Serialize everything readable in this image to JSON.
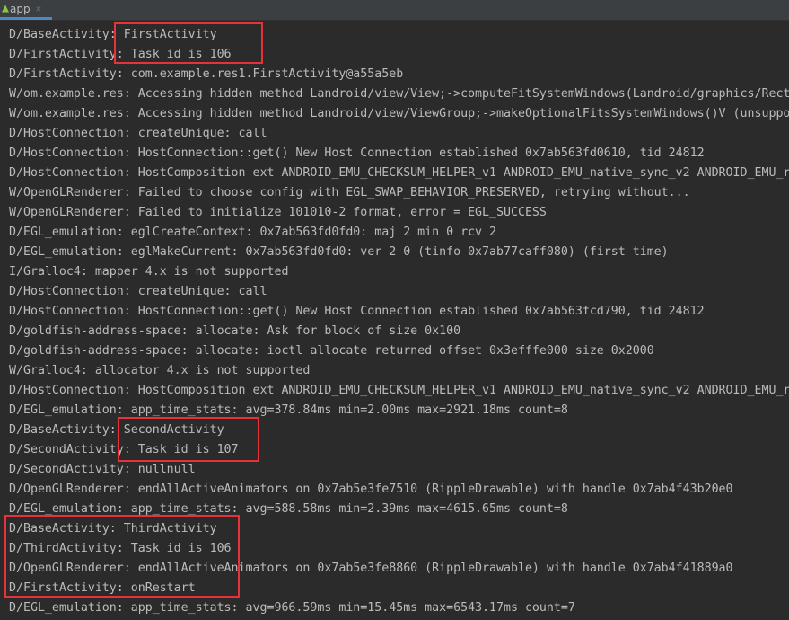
{
  "tab": {
    "label": "app",
    "close": "✕"
  },
  "highlight_color": "#e8323a",
  "log_lines": [
    "D/BaseActivity: FirstActivity",
    "D/FirstActivity: Task id is 106",
    "D/FirstActivity: com.example.res1.FirstActivity@a55a5eb",
    "W/om.example.res: Accessing hidden method Landroid/view/View;->computeFitSystemWindows(Landroid/graphics/Rect",
    "W/om.example.res: Accessing hidden method Landroid/view/ViewGroup;->makeOptionalFitsSystemWindows()V (unsuppo",
    "D/HostConnection: createUnique: call",
    "D/HostConnection: HostConnection::get() New Host Connection established 0x7ab563fd0610, tid 24812",
    "D/HostConnection: HostComposition ext ANDROID_EMU_CHECKSUM_HELPER_v1 ANDROID_EMU_native_sync_v2 ANDROID_EMU_r",
    "W/OpenGLRenderer: Failed to choose config with EGL_SWAP_BEHAVIOR_PRESERVED, retrying without...",
    "W/OpenGLRenderer: Failed to initialize 101010-2 format, error = EGL_SUCCESS",
    "D/EGL_emulation: eglCreateContext: 0x7ab563fd0fd0: maj 2 min 0 rcv 2",
    "D/EGL_emulation: eglMakeCurrent: 0x7ab563fd0fd0: ver 2 0 (tinfo 0x7ab77caff080) (first time)",
    "I/Gralloc4: mapper 4.x is not supported",
    "D/HostConnection: createUnique: call",
    "D/HostConnection: HostConnection::get() New Host Connection established 0x7ab563fcd790, tid 24812",
    "D/goldfish-address-space: allocate: Ask for block of size 0x100",
    "D/goldfish-address-space: allocate: ioctl allocate returned offset 0x3efffe000 size 0x2000",
    "W/Gralloc4: allocator 4.x is not supported",
    "D/HostConnection: HostComposition ext ANDROID_EMU_CHECKSUM_HELPER_v1 ANDROID_EMU_native_sync_v2 ANDROID_EMU_r",
    "D/EGL_emulation: app_time_stats: avg=378.84ms min=2.00ms max=2921.18ms count=8",
    "D/BaseActivity: SecondActivity",
    "D/SecondActivity: Task id is 107",
    "D/SecondActivity: nullnull",
    "D/OpenGLRenderer: endAllActiveAnimators on 0x7ab5e3fe7510 (RippleDrawable) with handle 0x7ab4f43b20e0",
    "D/EGL_emulation: app_time_stats: avg=588.58ms min=2.39ms max=4615.65ms count=8",
    "D/BaseActivity: ThirdActivity",
    "D/ThirdActivity: Task id is 106",
    "D/OpenGLRenderer: endAllActiveAnimators on 0x7ab5e3fe8860 (RippleDrawable) with handle 0x7ab4f41889a0",
    "D/FirstActivity: onRestart",
    "D/EGL_emulation: app_time_stats: avg=966.59ms min=15.45ms max=6543.17ms count=7"
  ]
}
